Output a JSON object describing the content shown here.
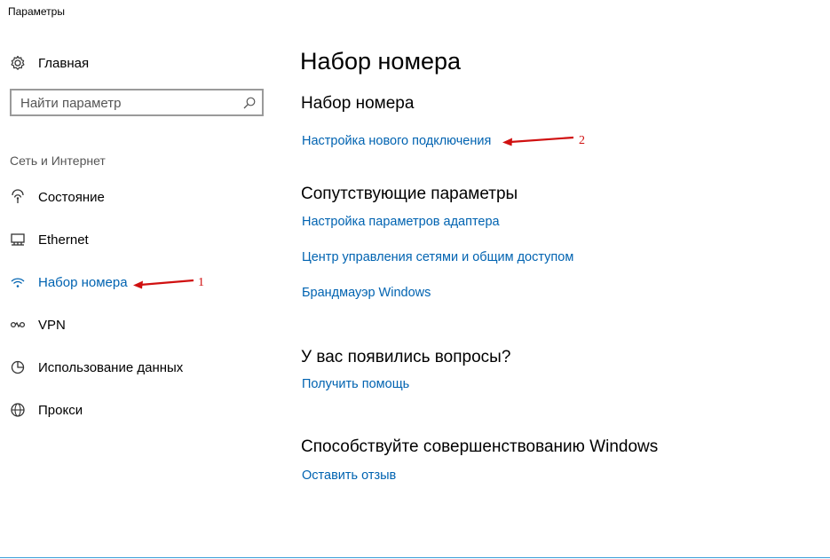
{
  "window": {
    "title": "Параметры"
  },
  "sidebar": {
    "home_label": "Главная",
    "search_placeholder": "Найти параметр",
    "section_label": "Сеть и Интернет",
    "items": [
      {
        "label": "Состояние",
        "icon": "status-icon"
      },
      {
        "label": "Ethernet",
        "icon": "ethernet-icon"
      },
      {
        "label": "Набор номера",
        "icon": "dialup-icon",
        "active": true
      },
      {
        "label": "VPN",
        "icon": "vpn-icon"
      },
      {
        "label": "Использование данных",
        "icon": "data-usage-icon"
      },
      {
        "label": "Прокси",
        "icon": "globe-icon"
      }
    ]
  },
  "main": {
    "title": "Набор номера",
    "dialup_heading": "Набор номера",
    "setup_link": "Настройка нового подключения",
    "related_heading": "Сопутствующие параметры",
    "related_links": [
      "Настройка параметров адаптера",
      "Центр управления сетями и общим доступом",
      "Брандмауэр Windows"
    ],
    "questions_heading": "У вас появились вопросы?",
    "help_link": "Получить помощь",
    "improve_heading": "Способствуйте совершенствованию Windows",
    "feedback_link": "Оставить отзыв"
  },
  "annotations": {
    "arrow1_label": "1",
    "arrow2_label": "2"
  },
  "colors": {
    "accent": "#0063b1",
    "annotation": "#d01010",
    "border": "#9a9a9a"
  }
}
